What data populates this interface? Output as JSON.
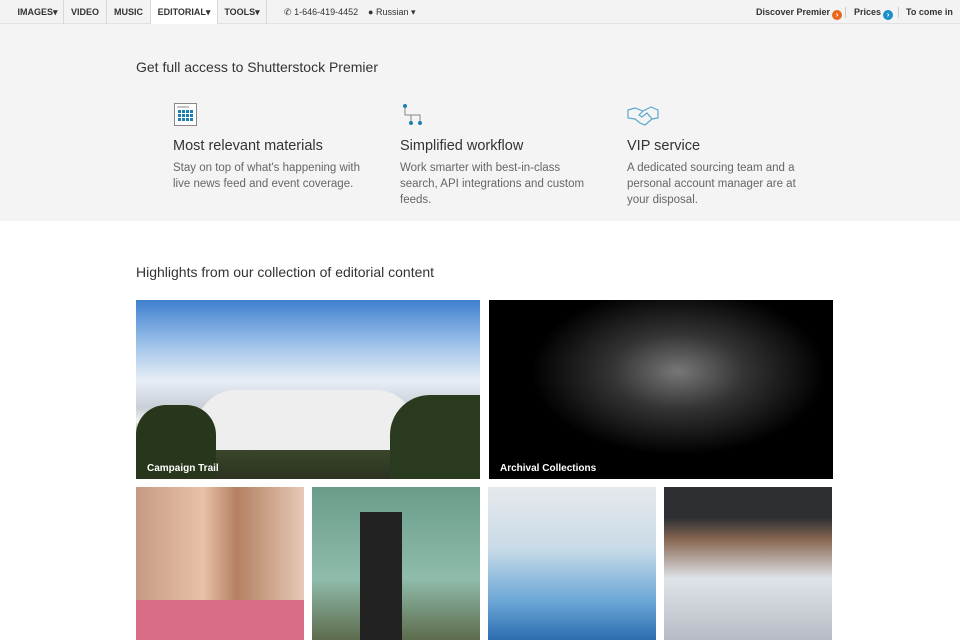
{
  "nav": {
    "items": [
      {
        "label": "IMAGES▾"
      },
      {
        "label": "VIDEO"
      },
      {
        "label": "MUSIC"
      },
      {
        "label": "EDITORIAL▾"
      },
      {
        "label": "TOOLS▾"
      }
    ],
    "phone": "1-646-419-4452",
    "language": "Russian ▾",
    "discover": "Discover Premier",
    "prices": "Prices",
    "login": "To come in"
  },
  "premier": {
    "title": "Get full access to Shutterstock Premier",
    "features": [
      {
        "icon": "calendar-grid-icon",
        "title": "Most relevant materials",
        "desc": "Stay on top of what's happening with live news feed and event coverage."
      },
      {
        "icon": "workflow-icon",
        "title": "Simplified workflow",
        "desc": "Work smarter with best-in-class search, API integrations and custom feeds."
      },
      {
        "icon": "handshake-icon",
        "title": "VIP service",
        "desc": "A dedicated sourcing team and a personal account manager are at your disposal."
      }
    ]
  },
  "highlights": {
    "title": "Highlights from our collection of editorial content",
    "tiles": [
      {
        "caption": "Campaign Trail"
      },
      {
        "caption": "Archival Collections"
      }
    ]
  }
}
